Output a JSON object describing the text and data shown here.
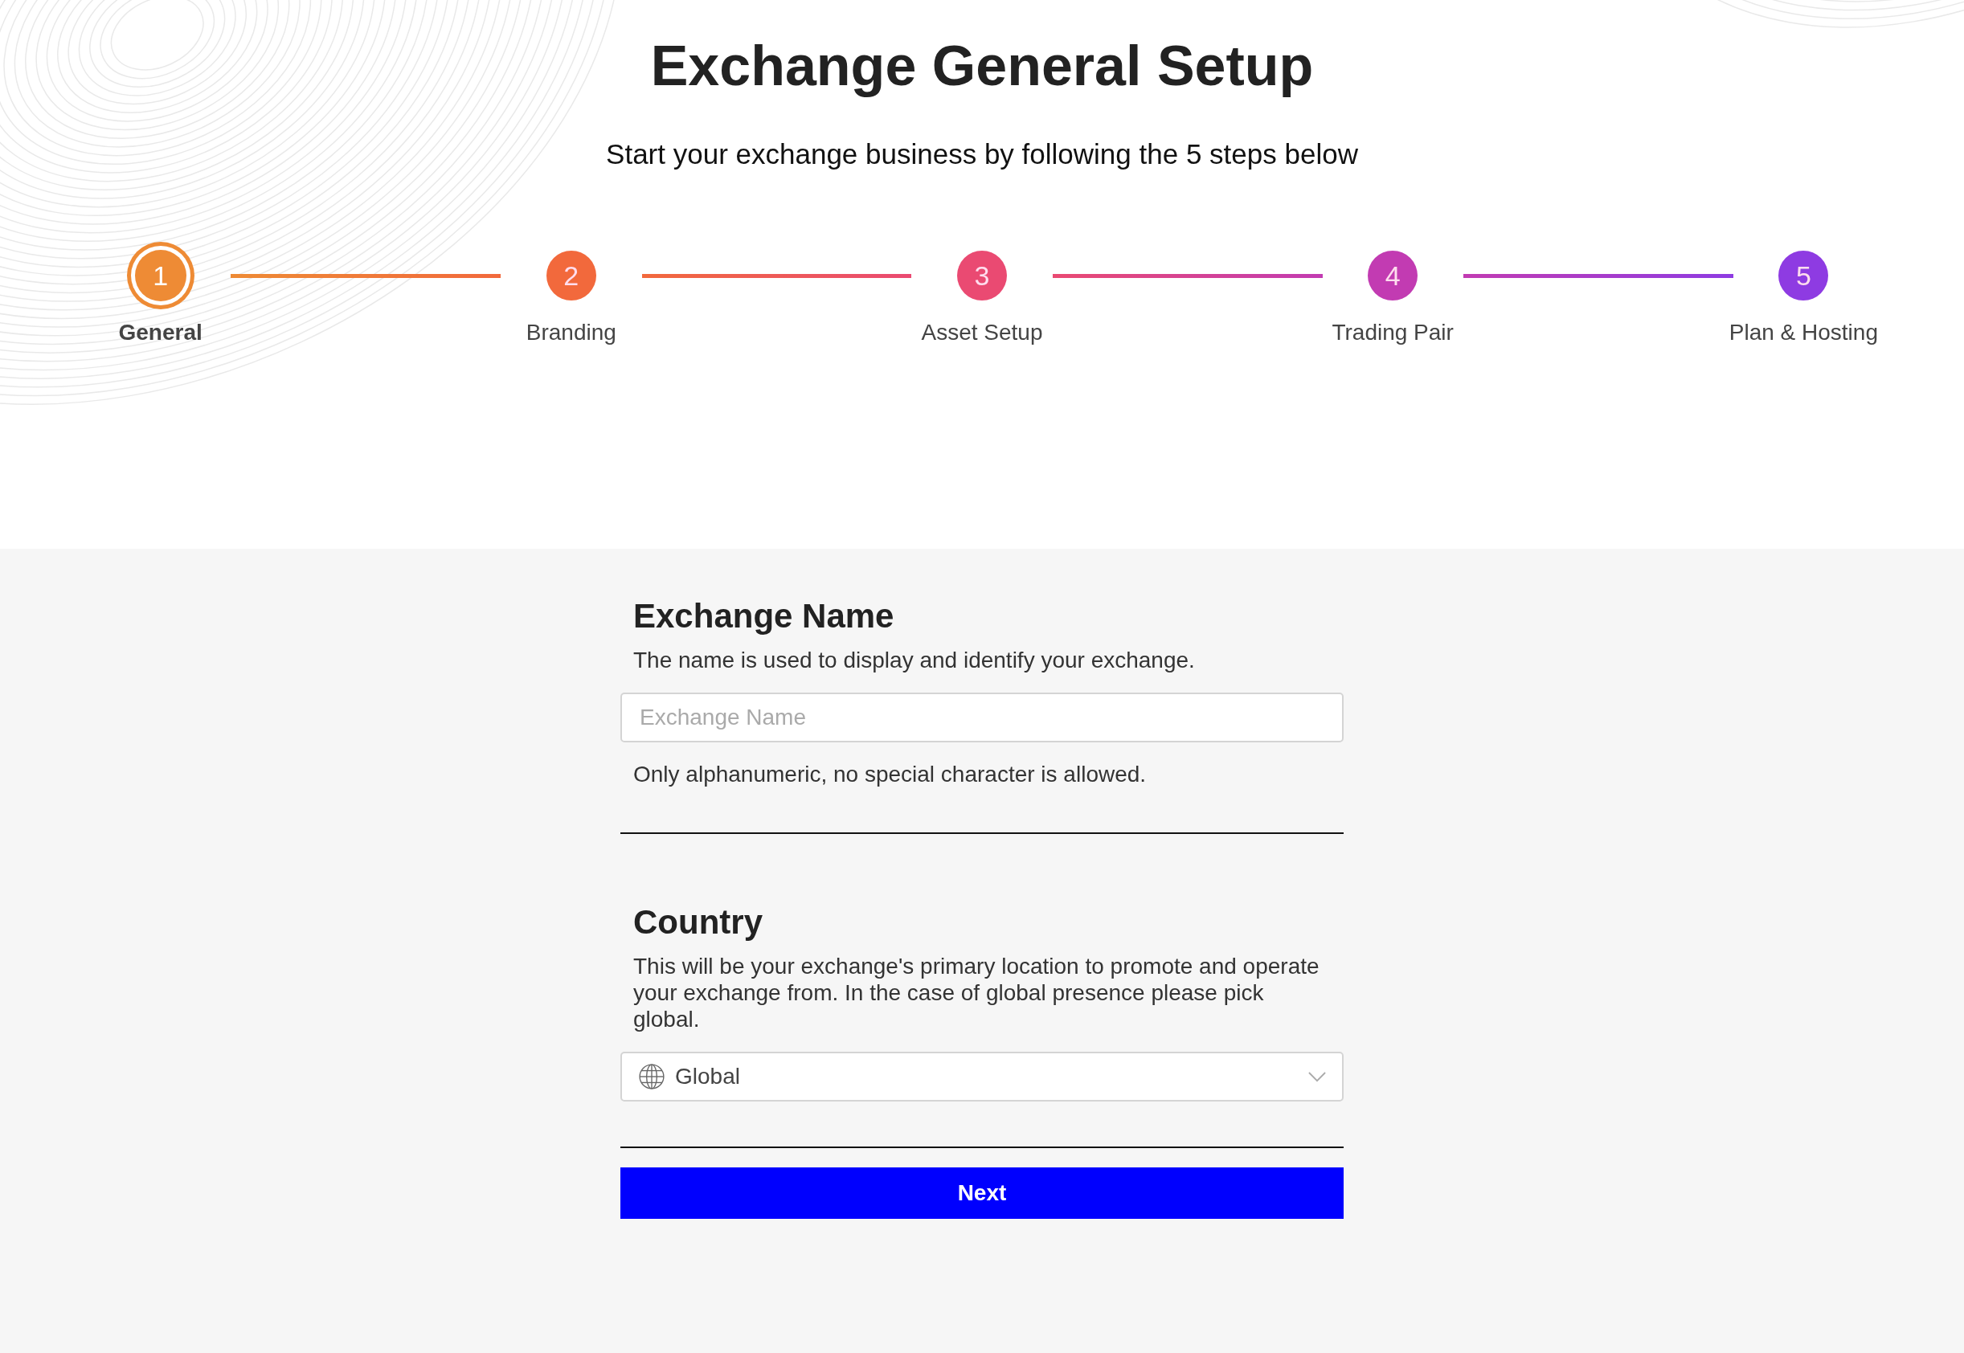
{
  "title": "Exchange General Setup",
  "subtitle": "Start your exchange business by following the 5 steps below",
  "steps": [
    {
      "number": "1",
      "label": "General",
      "color": "#ee8b35",
      "selected": true
    },
    {
      "number": "2",
      "label": "Branding",
      "color": "#f2693c",
      "selected": false
    },
    {
      "number": "3",
      "label": "Asset Setup",
      "color": "#ea4a72",
      "selected": false
    },
    {
      "number": "4",
      "label": "Trading Pair",
      "color": "#c23bb2",
      "selected": false
    },
    {
      "number": "5",
      "label": "Plan & Hosting",
      "color": "#8e3be2",
      "selected": false
    }
  ],
  "sections": [
    {
      "kind": "text",
      "heading": "Exchange Name",
      "description": "The name is used to display and identify your exchange.",
      "placeholder": "Exchange Name",
      "help": "Only alphanumeric, no special character is allowed."
    },
    {
      "kind": "select",
      "heading": "Country",
      "description": "This will be your exchange's primary location to promote and operate your exchange from. In the case of global presence please pick global.",
      "value": "Global"
    }
  ],
  "button": "Next"
}
